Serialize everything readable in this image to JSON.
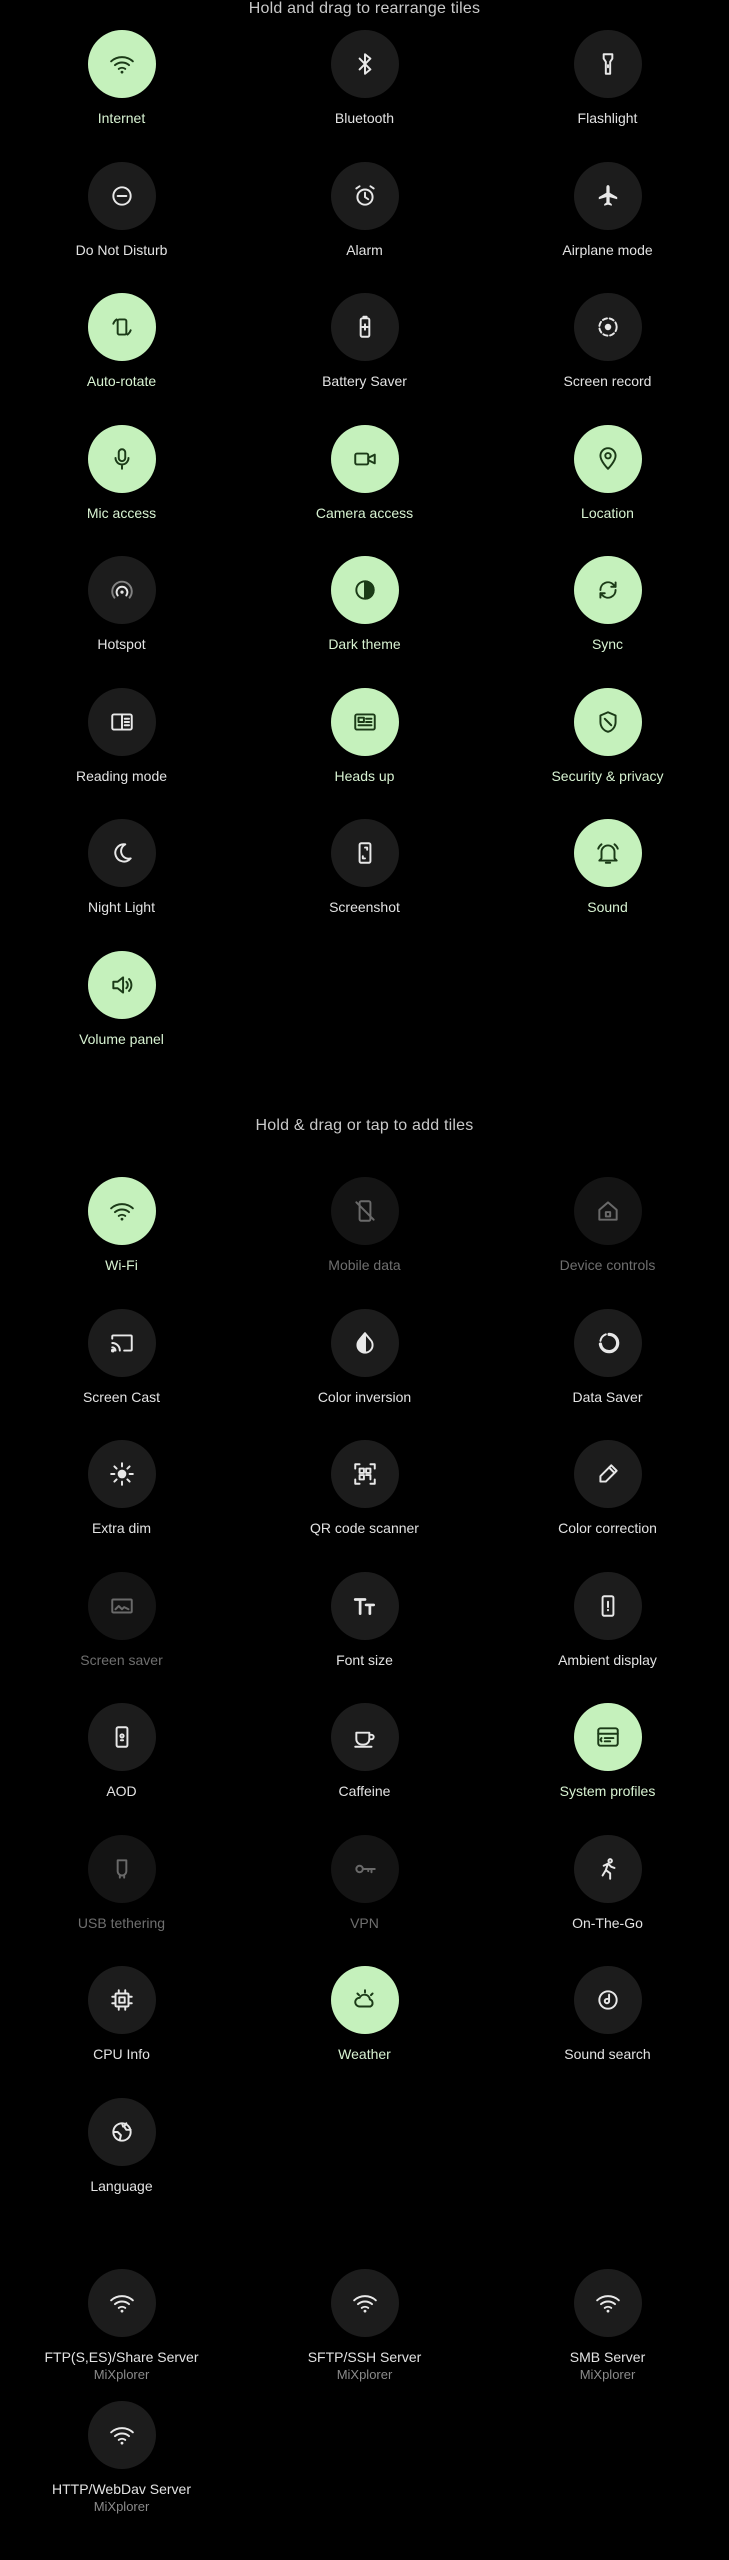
{
  "headers": {
    "rearrange": "Hold and drag to rearrange tiles",
    "add": "Hold & drag or tap to add tiles"
  },
  "colors": {
    "background": "#000000",
    "tile_on": "#c5f1bc",
    "tile_off": "#1c1c1c",
    "icon_on": "#1b3a17",
    "icon_off": "#e8e8e8",
    "icon_dim": "#6a6a6a"
  },
  "active_tiles": [
    {
      "label": "Internet",
      "icon": "wifi-icon",
      "state": "on"
    },
    {
      "label": "Bluetooth",
      "icon": "bluetooth-icon",
      "state": "off"
    },
    {
      "label": "Flashlight",
      "icon": "flashlight-icon",
      "state": "off"
    },
    {
      "label": "Do Not Disturb",
      "icon": "do-not-disturb-icon",
      "state": "off"
    },
    {
      "label": "Alarm",
      "icon": "alarm-icon",
      "state": "off"
    },
    {
      "label": "Airplane mode",
      "icon": "airplane-icon",
      "state": "off"
    },
    {
      "label": "Auto-rotate",
      "icon": "auto-rotate-icon",
      "state": "on"
    },
    {
      "label": "Battery Saver",
      "icon": "battery-saver-icon",
      "state": "off"
    },
    {
      "label": "Screen record",
      "icon": "screen-record-icon",
      "state": "off"
    },
    {
      "label": "Mic access",
      "icon": "mic-icon",
      "state": "on"
    },
    {
      "label": "Camera access",
      "icon": "camera-icon",
      "state": "on"
    },
    {
      "label": "Location",
      "icon": "location-icon",
      "state": "on"
    },
    {
      "label": "Hotspot",
      "icon": "hotspot-icon",
      "state": "off"
    },
    {
      "label": "Dark theme",
      "icon": "dark-theme-icon",
      "state": "on"
    },
    {
      "label": "Sync",
      "icon": "sync-icon",
      "state": "on"
    },
    {
      "label": "Reading mode",
      "icon": "reading-mode-icon",
      "state": "off"
    },
    {
      "label": "Heads up",
      "icon": "heads-up-icon",
      "state": "on"
    },
    {
      "label": "Security & privacy",
      "icon": "shield-icon",
      "state": "on"
    },
    {
      "label": "Night Light",
      "icon": "night-light-icon",
      "state": "off"
    },
    {
      "label": "Screenshot",
      "icon": "screenshot-icon",
      "state": "off"
    },
    {
      "label": "Sound",
      "icon": "bell-icon",
      "state": "on"
    },
    {
      "label": "Volume panel",
      "icon": "volume-icon",
      "state": "on"
    }
  ],
  "available_tiles": [
    {
      "label": "Wi-Fi",
      "icon": "wifi-icon",
      "state": "on"
    },
    {
      "label": "Mobile data",
      "icon": "mobile-data-off-icon",
      "state": "dim"
    },
    {
      "label": "Device controls",
      "icon": "home-icon",
      "state": "dim"
    },
    {
      "label": "Screen Cast",
      "icon": "cast-icon",
      "state": "off"
    },
    {
      "label": "Color inversion",
      "icon": "color-inversion-icon",
      "state": "off"
    },
    {
      "label": "Data Saver",
      "icon": "data-saver-icon",
      "state": "off"
    },
    {
      "label": "Extra dim",
      "icon": "brightness-icon",
      "state": "off"
    },
    {
      "label": "QR code scanner",
      "icon": "qr-scanner-icon",
      "state": "off"
    },
    {
      "label": "Color correction",
      "icon": "color-correction-icon",
      "state": "off"
    },
    {
      "label": "Screen saver",
      "icon": "screen-saver-icon",
      "state": "dim"
    },
    {
      "label": "Font size",
      "icon": "font-size-icon",
      "state": "off"
    },
    {
      "label": "Ambient display",
      "icon": "ambient-display-icon",
      "state": "off"
    },
    {
      "label": "AOD",
      "icon": "aod-icon",
      "state": "off"
    },
    {
      "label": "Caffeine",
      "icon": "coffee-icon",
      "state": "off"
    },
    {
      "label": "System profiles",
      "icon": "system-profiles-icon",
      "state": "on"
    },
    {
      "label": "USB tethering",
      "icon": "usb-icon",
      "state": "dim"
    },
    {
      "label": "VPN",
      "icon": "key-icon",
      "state": "dim"
    },
    {
      "label": "On-The-Go",
      "icon": "running-icon",
      "state": "off"
    },
    {
      "label": "CPU Info",
      "icon": "cpu-icon",
      "state": "off"
    },
    {
      "label": "Weather",
      "icon": "weather-icon",
      "state": "on"
    },
    {
      "label": "Sound search",
      "icon": "sound-search-icon",
      "state": "off"
    },
    {
      "label": "Language",
      "icon": "globe-icon",
      "state": "off"
    }
  ],
  "app_tiles": [
    {
      "label": "FTP(S,ES)/Share Server",
      "sublabel": "MiXplorer",
      "icon": "wifi-icon",
      "state": "off"
    },
    {
      "label": "SFTP/SSH Server",
      "sublabel": "MiXplorer",
      "icon": "wifi-icon",
      "state": "off"
    },
    {
      "label": "SMB Server",
      "sublabel": "MiXplorer",
      "icon": "wifi-icon",
      "state": "off"
    },
    {
      "label": "HTTP/WebDav Server",
      "sublabel": "MiXplorer",
      "icon": "wifi-icon",
      "state": "off"
    }
  ]
}
